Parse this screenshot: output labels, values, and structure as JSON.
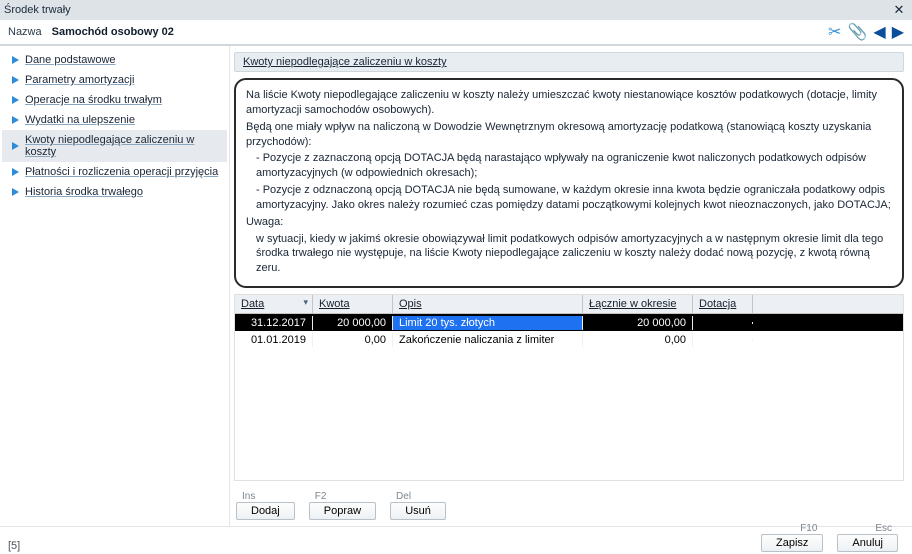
{
  "window_title": "Środek trwały",
  "header": {
    "name_label": "Nazwa",
    "name_value": "Samochód osobowy 02"
  },
  "sidebar": {
    "items": [
      {
        "label": "Dane podstawowe"
      },
      {
        "label": "Parametry amortyzacji"
      },
      {
        "label": "Operacje na środku trwałym"
      },
      {
        "label": "Wydatki na ulepszenie"
      },
      {
        "label": "Kwoty niepodlegające zaliczeniu w koszty",
        "selected": true
      },
      {
        "label": "Płatności i rozliczenia operacji przyjęcia"
      },
      {
        "label": "Historia środka trwałego"
      }
    ]
  },
  "panel_title": "Kwoty niepodlegające zaliczeniu w koszty",
  "help_text": {
    "p1": "Na liście Kwoty niepodlegające zaliczeniu w koszty należy umieszczać kwoty niestanowiące kosztów podatkowych (dotacje, limity amortyzacji samochodów osobowych).",
    "p2": "Będą one miały wpływ na naliczoną w Dowodzie Wewnętrznym okresową amortyzację podatkową (stanowiącą koszty uzyskania przychodów):",
    "b1": "- Pozycje z zaznaczoną opcją DOTACJA będą narastająco wpływały na ograniczenie kwot naliczonych podatkowych odpisów amortyzacyjnych (w odpowiednich okresach);",
    "b2": "- Pozycje z odznaczoną opcją DOTACJA nie będą sumowane, w każdym okresie inna kwota będzie ograniczała podatkowy odpis amortyzacyjny. Jako okres należy rozumieć czas pomiędzy datami początkowymi kolejnych kwot nieoznaczonych, jako DOTACJA;",
    "uwaga": "Uwaga:",
    "p3": "w sytuacji, kiedy w jakimś okresie obowiązywał limit podatkowych odpisów amortyzacyjnych a w następnym okresie limit dla tego środka trwałego nie występuje, na liście Kwoty niepodlegające zaliczeniu w koszty należy dodać nową pozycję, z kwotą równą zeru."
  },
  "grid": {
    "columns": {
      "data": "Data",
      "kwota": "Kwota",
      "opis": "Opis",
      "lacznie": "Łącznie w okresie",
      "dotacja": "Dotacja"
    },
    "rows": [
      {
        "data": "31.12.2017",
        "kwota": "20 000,00",
        "opis": "Limit 20 tys. złotych",
        "lacznie": "20 000,00",
        "dotacja": "",
        "selected": true
      },
      {
        "data": "01.01.2019",
        "kwota": "0,00",
        "opis": "Zakończenie naliczania z limiter",
        "lacznie": "0,00",
        "dotacja": ""
      }
    ]
  },
  "grid_actions": {
    "ins": "Ins",
    "dodaj": "Dodaj",
    "f2": "F2",
    "popraw": "Popraw",
    "del": "Del",
    "usun": "Usuń"
  },
  "footer": {
    "left": "[5]",
    "f10": "F10",
    "zapisz": "Zapisz",
    "esc": "Esc",
    "anuluj": "Anuluj"
  }
}
